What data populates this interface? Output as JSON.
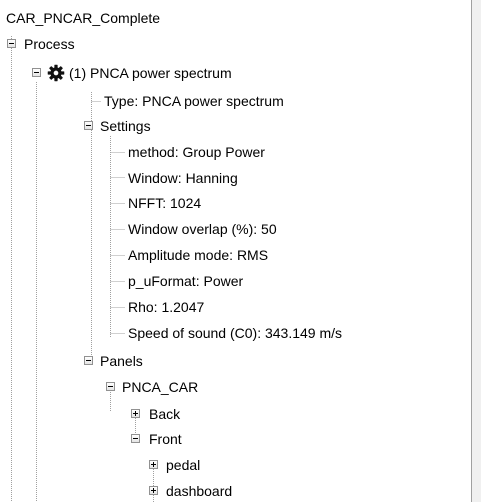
{
  "tree": {
    "root": "CAR_PNCAR_Complete",
    "process": "Process",
    "pnca": "(1) PNCA power spectrum",
    "type": "Type: PNCA power spectrum",
    "settings": "Settings",
    "settings_items": [
      "method: Group Power",
      "Window: Hanning",
      "NFFT: 1024",
      "Window overlap (%): 50",
      "Amplitude mode: RMS",
      "p_uFormat: Power",
      "Rho: 1.2047",
      "Speed of sound (C0): 343.149 m/s"
    ],
    "panels": "Panels",
    "pnca_car": "PNCA_CAR",
    "back": "Back",
    "front": "Front",
    "pedal": "pedal",
    "dashboard": "dashboard"
  },
  "icons": {
    "process_node": "gear-icon",
    "expanded": "minus-box-icon",
    "collapsed": "plus-box-icon"
  },
  "colors": {
    "tree_line": "#a0a0a0",
    "toggle_border": "#919191"
  }
}
